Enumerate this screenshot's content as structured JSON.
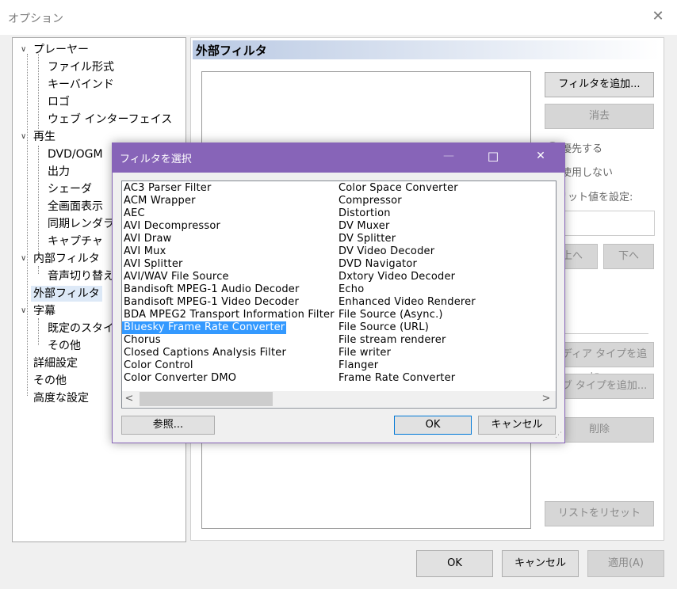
{
  "window": {
    "title": "オプション",
    "close_glyph": "✕"
  },
  "tree": {
    "nodes": [
      {
        "label": "プレーヤー"
      },
      {
        "label": "ファイル形式"
      },
      {
        "label": "キーバインド"
      },
      {
        "label": "ロゴ"
      },
      {
        "label": "ウェブ インターフェイス"
      },
      {
        "label": "再生"
      },
      {
        "label": "DVD/OGM"
      },
      {
        "label": "出力"
      },
      {
        "label": "シェーダ"
      },
      {
        "label": "全画面表示"
      },
      {
        "label": "同期レンダラの"
      },
      {
        "label": "キャプチャ"
      },
      {
        "label": "内部フィルタ"
      },
      {
        "label": "音声切り替え"
      },
      {
        "label": "外部フィルタ"
      },
      {
        "label": "字幕"
      },
      {
        "label": "既定のスタイル"
      },
      {
        "label": "その他"
      },
      {
        "label": "詳細設定"
      },
      {
        "label": "その他"
      },
      {
        "label": "高度な設定"
      }
    ]
  },
  "panel": {
    "title": "外部フィルタ",
    "add_filter": "フィルタを追加...",
    "delete": "消去",
    "prefer": "優先する",
    "dont_use": "使用しない",
    "merit_label": "メリット値を設定:",
    "up": "上へ",
    "down": "下へ",
    "add_media_type": "メディア タイプを追加...",
    "add_subtype": "サブ タイプを追加...",
    "remove": "削除",
    "reset_list": "リストをリセット"
  },
  "footer": {
    "ok": "OK",
    "cancel": "キャンセル",
    "apply": "適用(A)"
  },
  "dialog": {
    "title": "フィルタを選択",
    "minimize_glyph": "—",
    "maximize_glyph": "☐",
    "close_glyph": "✕",
    "col1": [
      "AC3 Parser Filter",
      "ACM Wrapper",
      "AEC",
      "AVI Decompressor",
      "AVI Draw",
      "AVI Mux",
      "AVI Splitter",
      "AVI/WAV File Source",
      "Bandisoft MPEG-1 Audio Decoder",
      "Bandisoft MPEG-1 Video Decoder",
      "BDA MPEG2 Transport Information Filter",
      "Bluesky Frame Rate Converter",
      "Chorus",
      "Closed Captions Analysis Filter",
      "Color Control",
      "Color Converter DMO"
    ],
    "col2": [
      "Color Space Converter",
      "Compressor",
      "Distortion",
      "DV Muxer",
      "DV Splitter",
      "DV Video Decoder",
      "DVD Navigator",
      "Dxtory Video Decoder",
      "Echo",
      "Enhanced Video Renderer",
      "File Source (Async.)",
      "File Source (URL)",
      "File stream renderer",
      "File writer",
      "Flanger",
      "Frame Rate Converter"
    ],
    "selected": "Bluesky Frame Rate Converter",
    "browse": "参照...",
    "ok": "OK",
    "cancel": "キャンセル",
    "scroll_left": "<",
    "scroll_right": ">"
  }
}
